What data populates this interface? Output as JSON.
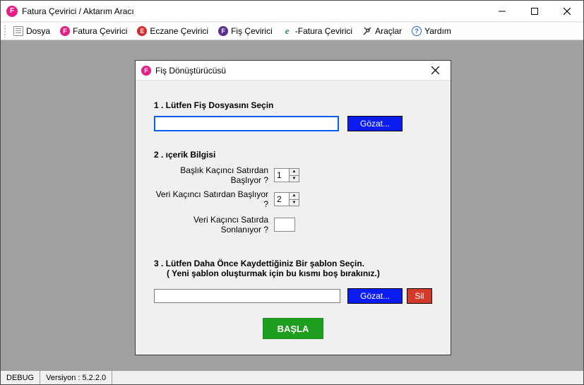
{
  "window": {
    "title": "Fatura Çevirici / Aktarım Aracı",
    "icon_letter": "F"
  },
  "toolbar": {
    "items": [
      {
        "label": "Dosya"
      },
      {
        "label": "Fatura Çevirici",
        "badge": "F"
      },
      {
        "label": "Eczane Çevirici",
        "badge": "E"
      },
      {
        "label": "Fiş Çevirici",
        "badge": "F"
      },
      {
        "label": "-Fatura Çevirici",
        "badge": "e"
      },
      {
        "label": "Araçlar"
      },
      {
        "label": "Yardım",
        "badge": "?"
      }
    ]
  },
  "dialog": {
    "title": "Fiş Dönüştürücüsü",
    "icon_letter": "F",
    "step1": {
      "label": "1 . Lütfen Fiş Dosyasını Seçin",
      "file_value": "",
      "browse_label": "Gözat..."
    },
    "step2": {
      "label": "2 . ıçerik Bilgisi",
      "header_row_label": "Başlık Kaçıncı Satırdan Başlıyor ?",
      "header_row_value": "1",
      "data_start_label": "Veri Kaçıncı Satırdan Başlıyor ?",
      "data_start_value": "2",
      "data_end_label": "Veri Kaçıncı Satırda Sonlanıyor ?",
      "data_end_value": ""
    },
    "step3": {
      "label_line1": "3 . Lütfen Daha Önce Kaydettiğiniz Bir şablon Seçin.",
      "label_line2": "( Yeni  şablon oluşturmak için bu kısmı boş bırakınız.)",
      "template_value": "",
      "browse_label": "Gözat...",
      "delete_label": "Sil"
    },
    "start_label": "BAŞLA"
  },
  "statusbar": {
    "mode": "DEBUG",
    "version_label": "Versiyon : 5.2.2.0"
  }
}
